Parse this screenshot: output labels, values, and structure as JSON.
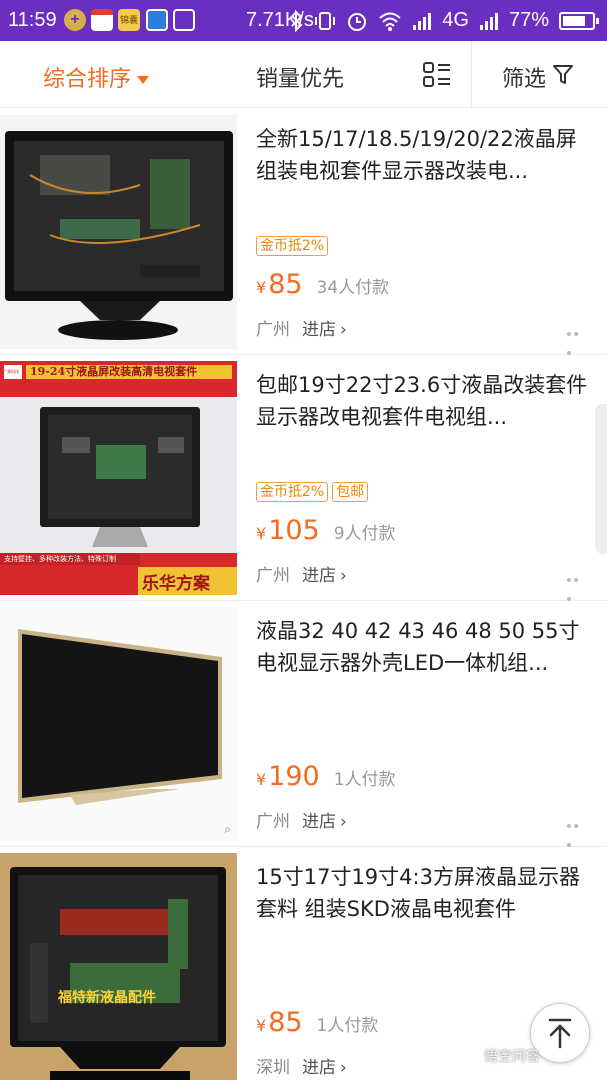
{
  "status_bar": {
    "time": "11:59",
    "app_icons": [
      "coin-icon",
      "news-app-icon",
      "yellow-app-icon",
      "shield-app-icon",
      "scan-app-icon"
    ],
    "app2_label": "锦囊",
    "speed": "7.71K/s",
    "network": "4G",
    "battery": "77%"
  },
  "sort_bar": {
    "default_label": "综合排序",
    "sales_label": "销量优先",
    "filter_label": "筛选",
    "accent": "#f56a1e"
  },
  "items": [
    {
      "title": "全新15/17/18.5/19/20/22液晶屏组装电视套件显示器改装电...",
      "tags": [
        "金币抵2%"
      ],
      "currency": "¥",
      "price": "85",
      "paid": "34人付款",
      "location": "广州",
      "shop": "进店"
    },
    {
      "title": "包邮19寸22寸23.6寸液晶改装套件显示器改电视套件电视组...",
      "tags": [
        "金币抵2%",
        "包邮"
      ],
      "currency": "¥",
      "price": "105",
      "paid": "9人付款",
      "location": "广州",
      "shop": "进店",
      "image_banner": "19-24寸液晶屏改装高清电视套件",
      "image_brand": "乐华方案",
      "image_logo": "广源科技",
      "image_caption": "支持壁挂、多种改装方法、特殊订制"
    },
    {
      "title": "液晶32 40 42 43 46 48 50 55寸电视显示器外壳LED一体机组...",
      "tags": [],
      "currency": "¥",
      "price": "190",
      "paid": "1人付款",
      "location": "广州",
      "shop": "进店"
    },
    {
      "title": "15寸17寸19寸4:3方屏液晶显示器套料 组装SKD液晶电视套件",
      "tags": [],
      "currency": "¥",
      "price": "85",
      "paid": "1人付款",
      "location": "深圳",
      "shop": "进店",
      "image_text": "福特新液晶配件"
    }
  ],
  "overlay": {
    "watermark": "悟空问答"
  }
}
